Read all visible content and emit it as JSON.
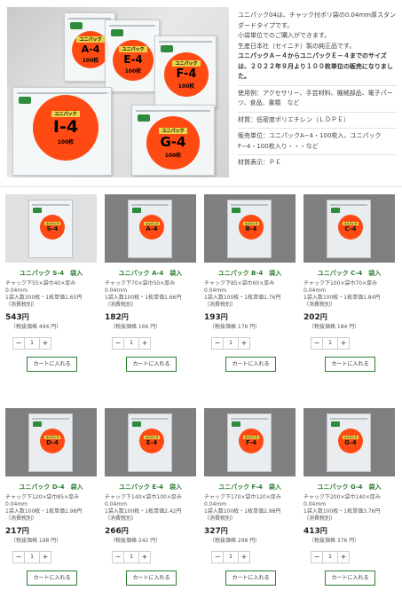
{
  "hero": {
    "bags": [
      {
        "code": "A-4",
        "count": "100枚"
      },
      {
        "code": "E-4",
        "count": "100枚"
      },
      {
        "code": "F-4",
        "count": "100枚"
      },
      {
        "code": "I-4",
        "count": "100枚"
      },
      {
        "code": "G-4",
        "count": "100枚"
      }
    ],
    "brand_text": "ユニパック"
  },
  "description": {
    "intro_1": "ユニパック04は、チャック付ポリ袋の0.04mm厚スタンダードタイプです。",
    "intro_2": "小袋単位でのご購入ができます。",
    "intro_3": "生産日本社（セイニチ）製の純正品です。",
    "notice": "ユニパックＡ－４からユニパックＥ－４までのサイズは、２０２２年９月より１００枚単位の販売になりました。",
    "usage": "使用例：アクセサリー、手芸材料、機械部品、電子パーツ、食品、書類　など",
    "material": "材質：低密度ポリエチレン（ＬＤＰＥ）",
    "unit": "販売単位：ユニパックA−4・100枚入、ユニパックF−4・100枚入り・・・など",
    "label": "材質表示：ＰＥ"
  },
  "products": [
    {
      "code": "S-4",
      "name": "ユニパック S-4　袋入",
      "spec": "チャック下55×袋巾40×厚み0.04mm",
      "unit": "1袋入数300枚・1枚単価1.65円",
      "tax_note": "（消費税別）",
      "price": "543",
      "yen": "円",
      "tax_in": "（税抜価格 494 円）",
      "qty": "1",
      "minus": "−",
      "plus": "+",
      "cart": "カートに入れる"
    },
    {
      "code": "A-4",
      "name": "ユニパック A-4　袋入",
      "spec": "チャック下70×袋巾50×厚み0.04mm",
      "unit": "1袋入数100枚・1枚単価1.66円",
      "tax_note": "（消費税別）",
      "price": "182",
      "yen": "円",
      "tax_in": "（税抜価格 166 円）",
      "qty": "1",
      "minus": "−",
      "plus": "+",
      "cart": "カートに入れる"
    },
    {
      "code": "B-4",
      "name": "ユニパック B-4　袋入",
      "spec": "チャック下85×袋巾60×厚み0.04mm",
      "unit": "1袋入数100枚・1枚単価1.76円",
      "tax_note": "（消費税別）",
      "price": "193",
      "yen": "円",
      "tax_in": "（税抜価格 176 円）",
      "qty": "1",
      "minus": "−",
      "plus": "+",
      "cart": "カートに入れる"
    },
    {
      "code": "C-4",
      "name": "ユニパック C-4　袋入",
      "spec": "チャック下100×袋巾70×厚み0.04mm",
      "unit": "1袋入数100枚・1枚単価1.84円",
      "tax_note": "（消費税別）",
      "price": "202",
      "yen": "円",
      "tax_in": "（税抜価格 184 円）",
      "qty": "1",
      "minus": "−",
      "plus": "+",
      "cart": "カートに入れる"
    },
    {
      "code": "D-4",
      "name": "ユニパック D-4　袋入",
      "spec": "チャック下120×袋巾85×厚み0.04mm",
      "unit": "1袋入数100枚・1枚単価1.98円",
      "tax_note": "（消費税別）",
      "price": "217",
      "yen": "円",
      "tax_in": "（税抜価格 198 円）",
      "qty": "1",
      "minus": "−",
      "plus": "+",
      "cart": "カートに入れる"
    },
    {
      "code": "E-4",
      "name": "ユニパック E-4　袋入",
      "spec": "チャック下140×袋巾100×厚み0.04mm",
      "unit": "1袋入数100枚・1枚単価2.42円",
      "tax_note": "（消費税別）",
      "price": "266",
      "yen": "円",
      "tax_in": "（税抜価格 242 円）",
      "qty": "1",
      "minus": "−",
      "plus": "+",
      "cart": "カートに入れる"
    },
    {
      "code": "F-4",
      "name": "ユニパック F-4　袋入",
      "spec": "チャック下170×袋巾120×厚み0.04mm",
      "unit": "1袋入数100枚・1枚単価2.98円",
      "tax_note": "（消費税別）",
      "price": "327",
      "yen": "円",
      "tax_in": "（税抜価格 298 円）",
      "qty": "1",
      "minus": "−",
      "plus": "+",
      "cart": "カートに入れる"
    },
    {
      "code": "G-4",
      "name": "ユニパック G-4　袋入",
      "spec": "チャック下200×袋巾140×厚み0.04mm",
      "unit": "1袋入数100枚・1枚単価3.76円",
      "tax_note": "（消費税別）",
      "price": "413",
      "yen": "円",
      "tax_in": "（税抜価格 376 円）",
      "qty": "1",
      "minus": "−",
      "plus": "+",
      "cart": "カートに入れる"
    }
  ],
  "colors": {
    "accent_green": "#2e7d32",
    "disc_orange": "#ff4a14"
  }
}
